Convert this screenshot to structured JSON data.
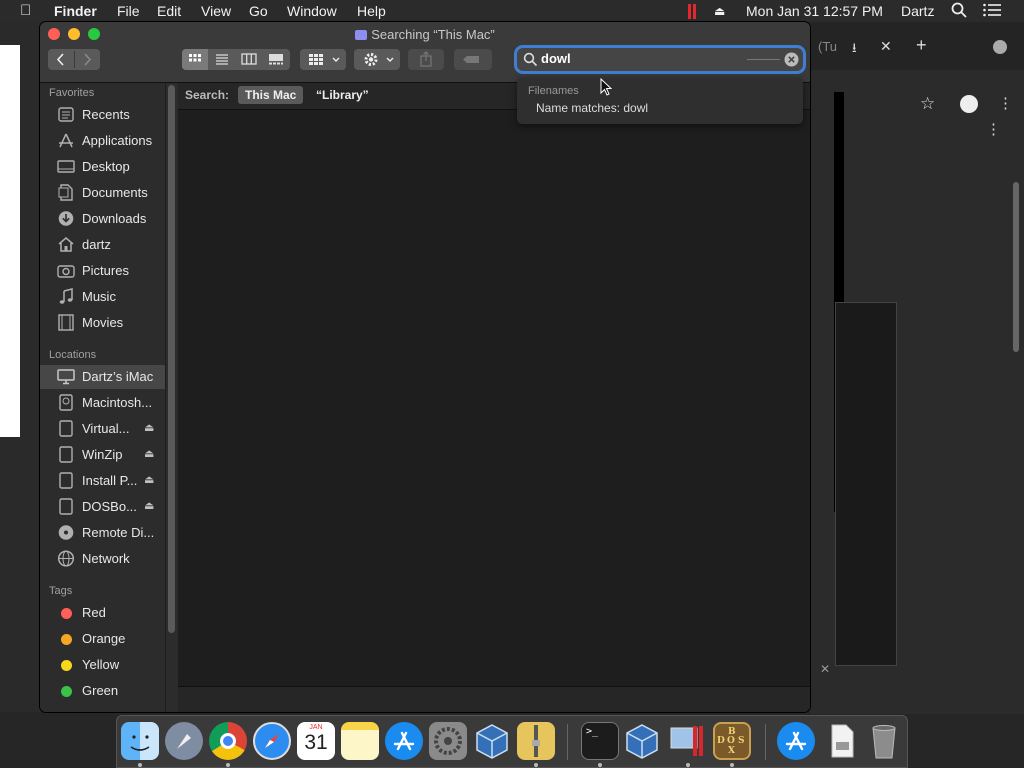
{
  "menubar": {
    "apple_icon": "apple-icon",
    "app": "Finder",
    "menus": [
      "File",
      "Edit",
      "View",
      "Go",
      "Window",
      "Help"
    ],
    "clock": "Mon Jan 31  12:57 PM",
    "user": "Dartz"
  },
  "window": {
    "title": "Searching “This Mac”",
    "search": {
      "value": "dowl"
    },
    "scope": {
      "label": "Search:",
      "this_mac": "This Mac",
      "library": "“Library”"
    }
  },
  "suggestions": {
    "header": "Filenames",
    "item": "Name matches: dowl"
  },
  "sidebar": {
    "favorites_title": "Favorites",
    "favorites": [
      {
        "label": "Recents",
        "icon": "clock-icon"
      },
      {
        "label": "Applications",
        "icon": "applications-icon"
      },
      {
        "label": "Desktop",
        "icon": "desktop-icon"
      },
      {
        "label": "Documents",
        "icon": "document-icon"
      },
      {
        "label": "Downloads",
        "icon": "download-icon"
      },
      {
        "label": "dartz",
        "icon": "home-icon"
      },
      {
        "label": "Pictures",
        "icon": "camera-icon"
      },
      {
        "label": "Music",
        "icon": "music-icon"
      },
      {
        "label": "Movies",
        "icon": "film-icon"
      }
    ],
    "locations_title": "Locations",
    "locations": [
      {
        "label": "Dartz’s iMac",
        "icon": "imac-icon",
        "selected": true
      },
      {
        "label": "Macintosh...",
        "icon": "disk-icon"
      },
      {
        "label": "Virtual...",
        "icon": "disk-icon",
        "eject": true
      },
      {
        "label": "WinZip",
        "icon": "disk-icon",
        "eject": true
      },
      {
        "label": "Install P...",
        "icon": "disk-icon",
        "eject": true
      },
      {
        "label": "DOSBo...",
        "icon": "disk-icon",
        "eject": true
      },
      {
        "label": "Remote Di...",
        "icon": "disc-icon"
      },
      {
        "label": "Network",
        "icon": "network-icon"
      }
    ],
    "tags_title": "Tags",
    "tags": [
      {
        "label": "Red",
        "color": "#ff5f57"
      },
      {
        "label": "Orange",
        "color": "#f5a623"
      },
      {
        "label": "Yellow",
        "color": "#f8d81c"
      },
      {
        "label": "Green",
        "color": "#38c348"
      }
    ]
  },
  "colors": {
    "accent": "#3f7fd3"
  },
  "dock": {
    "items": [
      "finder-icon",
      "launchpad-icon",
      "chrome-icon",
      "safari-icon",
      "calendar-icon",
      "notes-icon",
      "app-store-icon",
      "system-preferences-icon",
      "virtualbox-icon",
      "archive-utility-icon",
      "terminal-icon",
      "virtualbox-icon",
      "parallels-icon",
      "dosbox-icon",
      "app-store-icon",
      "document-icon",
      "trash-icon"
    ],
    "calendar_month": "JAN",
    "calendar_day": "31"
  }
}
